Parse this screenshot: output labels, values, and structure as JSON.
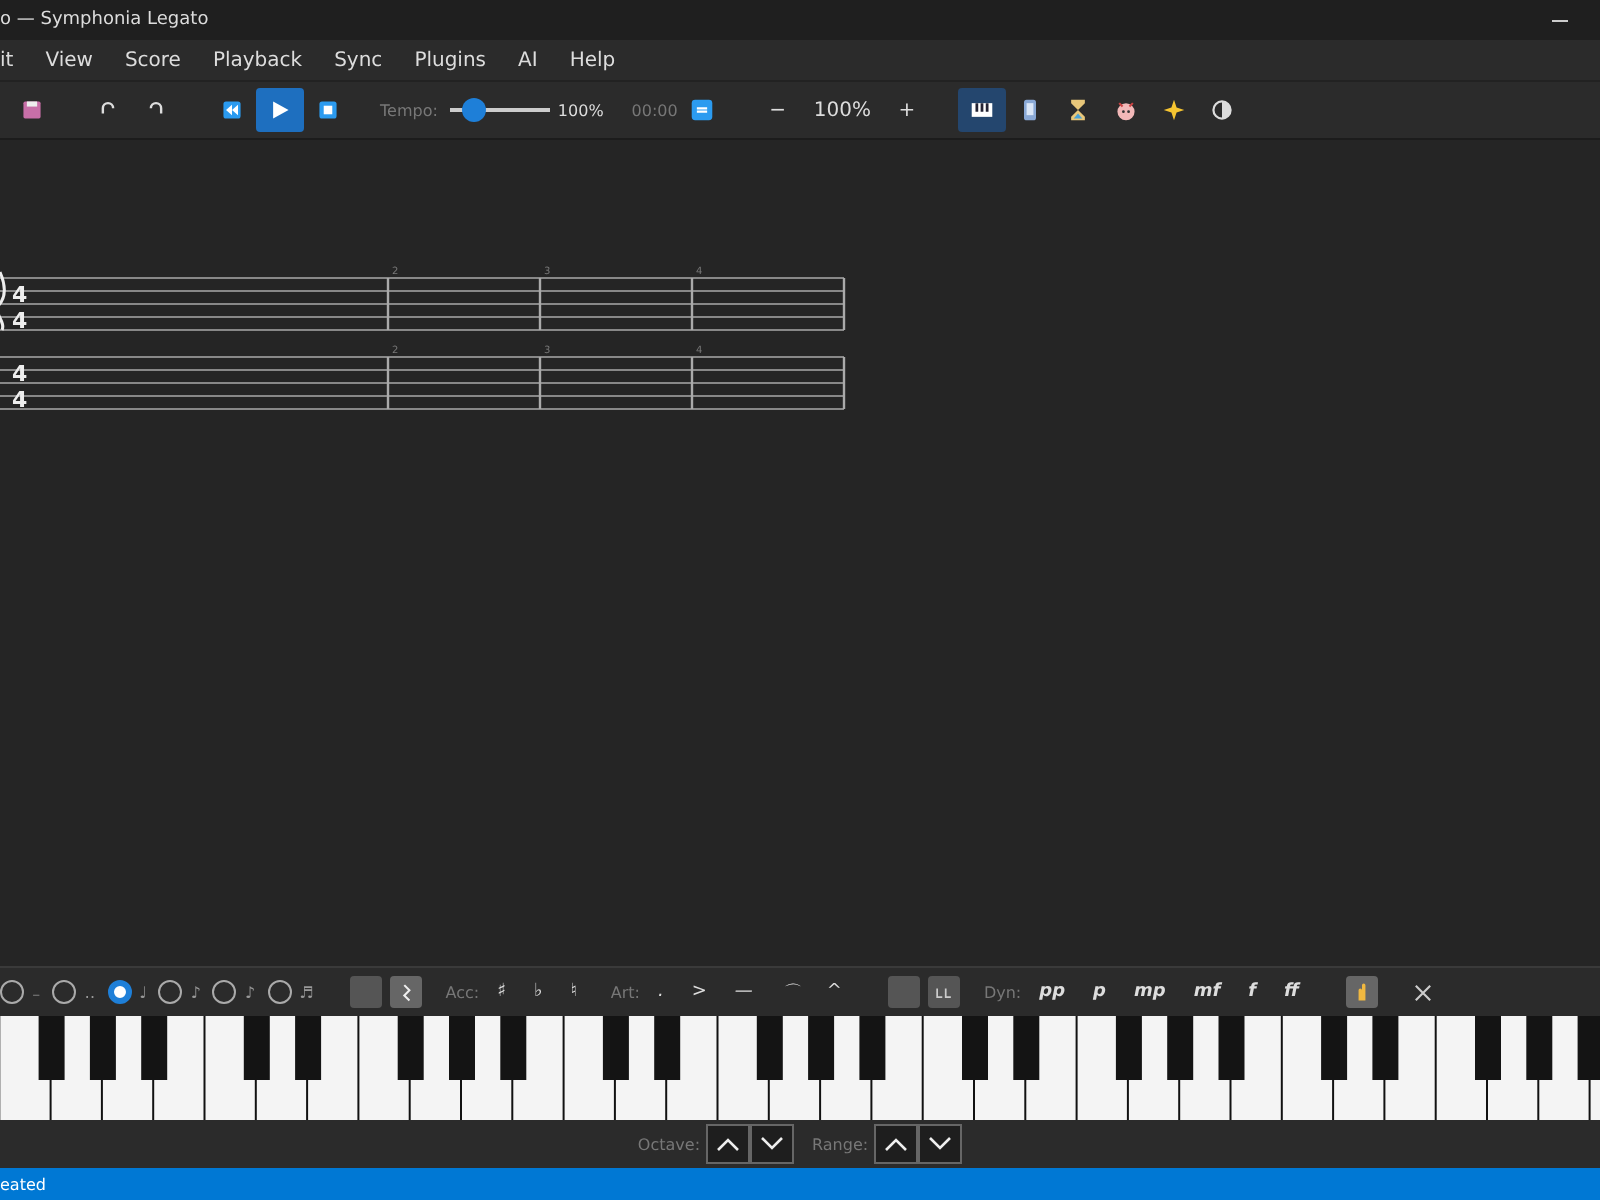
{
  "window": {
    "title": "o — Symphonia Legato"
  },
  "menu": [
    "it",
    "View",
    "Score",
    "Playback",
    "Sync",
    "Plugins",
    "AI",
    "Help"
  ],
  "toolbar": {
    "edit": [
      {
        "kind": "save"
      },
      {
        "kind": "undo"
      },
      {
        "kind": "redo"
      }
    ],
    "transport": [
      {
        "kind": "rewind",
        "selected": false
      },
      {
        "kind": "play",
        "selected": true
      },
      {
        "kind": "stop",
        "selected": false
      }
    ],
    "tempo": {
      "label": "Tempo:",
      "level": 0.25,
      "reading": "100%"
    },
    "time": "00:00",
    "loop": {
      "on": true
    },
    "zoom": {
      "out": "−",
      "reading": "100%",
      "in": "+"
    },
    "views": [
      {
        "kind": "piano",
        "selected": true
      },
      {
        "kind": "phone",
        "selected": false
      },
      {
        "kind": "hourglass",
        "selected": false
      },
      {
        "kind": "face",
        "selected": false
      },
      {
        "kind": "sparkle",
        "selected": false
      },
      {
        "kind": "contrast",
        "selected": false
      }
    ]
  },
  "score": {
    "staves": [
      {
        "clef": true,
        "time": [
          "4",
          "4"
        ],
        "measure_numbers": [
          "2",
          "3",
          "4"
        ]
      },
      {
        "time": [
          "4",
          "4"
        ],
        "measure_numbers": [
          "2",
          "3",
          "4"
        ]
      }
    ]
  },
  "palette": {
    "durations": [
      {
        "glyph": "₋",
        "selected": false
      },
      {
        "glyph": "‥",
        "selected": false
      },
      {
        "glyph": "♩",
        "selected": true
      },
      {
        "glyph": "♪",
        "selected": false
      },
      {
        "glyph": "♪",
        "selected": false
      },
      {
        "glyph": "♬",
        "selected": false
      }
    ],
    "toggles": [
      {
        "kind": "blank",
        "selected": false
      },
      {
        "kind": "rest",
        "selected": true
      }
    ],
    "accidentals": {
      "label": "Acc:",
      "items": [
        "♯",
        "♭",
        "♮"
      ]
    },
    "articulations": {
      "label": "Art:",
      "items": [
        ".",
        ">",
        "—",
        "⌒",
        "^"
      ]
    },
    "tools": [
      {
        "kind": "blank",
        "selected": false
      },
      {
        "kind": "tuplet",
        "selected": false
      }
    ],
    "dynamics": {
      "label": "Dyn:",
      "items": [
        "pp",
        "p",
        "mp",
        "mf",
        "f",
        "ff"
      ]
    },
    "hand": {
      "selected": true
    }
  },
  "octave": {
    "label": "Octave:"
  },
  "range": {
    "label": "Range:"
  },
  "status": "eated"
}
